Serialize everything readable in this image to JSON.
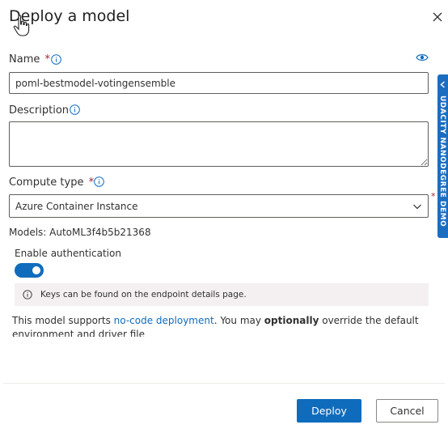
{
  "dialog": {
    "title": "Deploy a model",
    "name_label": "Name",
    "required_mark": "*",
    "name_value": "poml-bestmodel-votingensemble",
    "description_label": "Description",
    "description_value": "",
    "compute_label": "Compute type",
    "compute_value": "Azure Container Instance",
    "models_text": "Models: AutoML3f4b5b21368",
    "auth_label": "Enable authentication",
    "auth_enabled": true,
    "auth_note": "Keys can be found on the endpoint details page.",
    "support_prefix": "This model supports ",
    "support_link": "no-code deployment",
    "support_mid": ". You may ",
    "support_bold": "optionally",
    "support_suffix": " override the default environment and driver file",
    "deploy_label": "Deploy",
    "cancel_label": "Cancel"
  },
  "side_tab": {
    "label": "UDACITY NANODEGREE DEMO"
  },
  "icons": {
    "close": "close-icon",
    "info": "info-icon",
    "eye": "eye-icon",
    "dropdown": "chevron-down-icon",
    "cursor": "hand-cursor-icon"
  },
  "colors": {
    "accent": "#0f6cbd",
    "required": "#a4262c",
    "side_tab": "#1b6dbf"
  }
}
